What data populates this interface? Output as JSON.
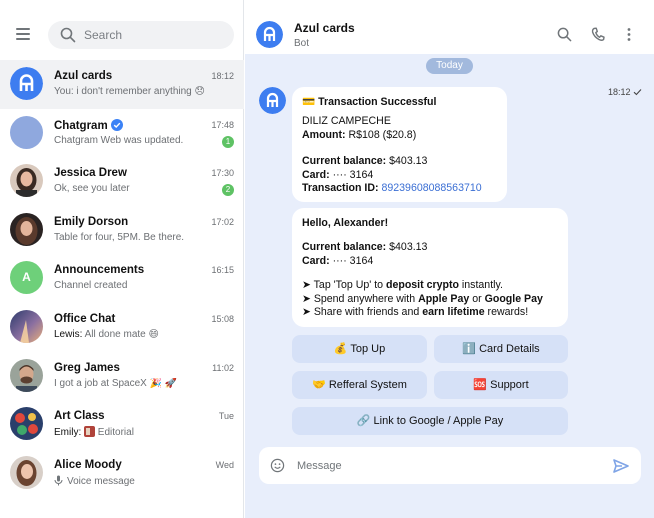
{
  "search": {
    "placeholder": "Search"
  },
  "chats": [
    {
      "name": "Azul cards",
      "time": "18:12",
      "preview": "You: i don't remember anything 😞",
      "active": true
    },
    {
      "name": "Chatgram",
      "time": "17:48",
      "preview": "Chatgram Web was updated.",
      "unread": "1",
      "verified": true
    },
    {
      "name": "Jessica Drew",
      "time": "17:30",
      "preview": "Ok, see you later",
      "unread": "2"
    },
    {
      "name": "Emily Dorson",
      "time": "17:02",
      "preview": "Table for four, 5PM. Be there."
    },
    {
      "name": "Announcements",
      "time": "16:15",
      "preview": "Channel created",
      "initial": "A"
    },
    {
      "name": "Office Chat",
      "time": "15:08",
      "sender": "Lewis:",
      "preview": "All done mate 😄"
    },
    {
      "name": "Greg James",
      "time": "11:02",
      "preview": "I got a job at SpaceX 🎉 🚀"
    },
    {
      "name": "Art Class",
      "time": "Tue",
      "sender": "Emily:",
      "preview": "Editorial"
    },
    {
      "name": "Alice Moody",
      "time": "Wed",
      "preview": "Voice message"
    }
  ],
  "header": {
    "title": "Azul cards",
    "subtitle": "Bot"
  },
  "date_divider": "Today",
  "message_time": "18:12",
  "msg1": {
    "title": "💳 Transaction Successful",
    "merchant": "DILIZ CAMPECHE",
    "amount_label": "Amount:",
    "amount_value": "R$108 ($20.8)",
    "balance_label": "Current balance:",
    "balance_value": "$403.13",
    "card_label": "Card:",
    "card_value": "···· 3164",
    "txn_label": "Transaction ID:",
    "txn_value": "89239608088563710"
  },
  "msg2": {
    "greeting": "Hello, Alexander!",
    "balance_label": "Current balance:",
    "balance_value": "$403.13",
    "card_label": "Card:",
    "card_value": "···· 3164",
    "l1_pre": "➤ Tap 'Top Up' to ",
    "l1_bold": "deposit crypto",
    "l1_post": " instantly.",
    "l2_pre": "➤ Spend anywhere with ",
    "l2_bold1": "Apple Pay",
    "l2_mid": " or ",
    "l2_bold2": "Google Pay",
    "l3_pre": "➤ Share with friends and ",
    "l3_bold": "earn lifetime",
    "l3_post": " rewards!"
  },
  "buttons": {
    "top_up": "💰 Top Up",
    "card_details": "ℹ️ Card Details",
    "referral": "🤝 Refferal System",
    "support": "🆘 Support",
    "link_pay": "🔗 Link to Google / Apple Pay"
  },
  "composer": {
    "placeholder": "Message"
  },
  "colors": {
    "accent": "#3b82f6",
    "online": "#5ec264",
    "bg": "#e8eefb"
  }
}
